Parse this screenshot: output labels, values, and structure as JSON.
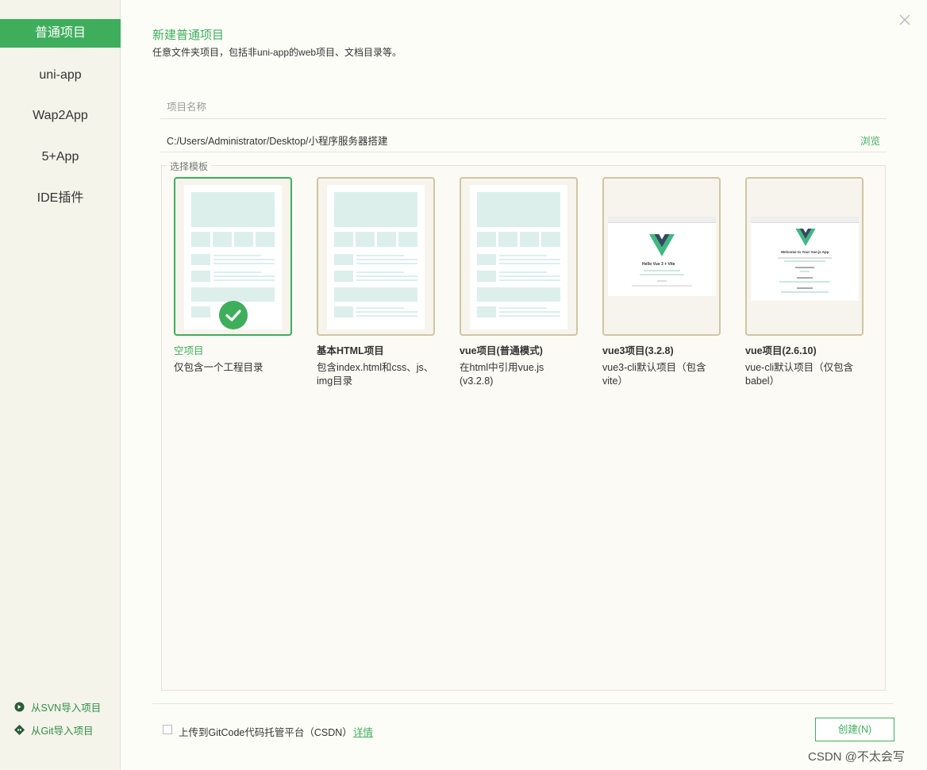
{
  "sidebar": {
    "items": [
      {
        "label": "普通项目",
        "active": true
      },
      {
        "label": "uni-app"
      },
      {
        "label": "Wap2App"
      },
      {
        "label": "5+App"
      },
      {
        "label": "IDE插件"
      }
    ],
    "svn_import": "从SVN导入项目",
    "git_import": "从Git导入项目"
  },
  "header": {
    "title": "新建普通项目",
    "subtitle": "任意文件夹项目，包括非uni-app的web项目、文档目录等。"
  },
  "form": {
    "name_placeholder": "项目名称",
    "path": "C:/Users/Administrator/Desktop/小程序服务器搭建",
    "browse_label": "浏览",
    "template_legend": "选择模板"
  },
  "templates": [
    {
      "title": "空项目",
      "desc": "仅包含一个工程目录",
      "selected": true
    },
    {
      "title": "基本HTML项目",
      "desc": "包含index.html和css、js、img目录"
    },
    {
      "title": "vue项目(普通模式)",
      "desc": "在html中引用vue.js (v3.2.8)"
    },
    {
      "title": "vue3项目(3.2.8)",
      "desc": "vue3-cli默认项目（包含vite）"
    },
    {
      "title": "vue项目(2.6.10)",
      "desc": "vue-cli默认项目（仅包含babel）"
    }
  ],
  "preview_texts": {
    "vite_heading": "Hello Vue 3 + Vite",
    "vue2_heading": "Welcome to Your Vue.js App"
  },
  "footer": {
    "upload_label": "上传到GitCode代码托管平台（CSDN）",
    "details_label": "详情",
    "create_label": "创建(N)",
    "watermark": "CSDN @不太会写"
  },
  "colors": {
    "accent": "#3fae5c",
    "sidebar_bg": "#f5f4ea",
    "card_border": "#cfc6a3",
    "thumb_block": "#dcefeb"
  }
}
